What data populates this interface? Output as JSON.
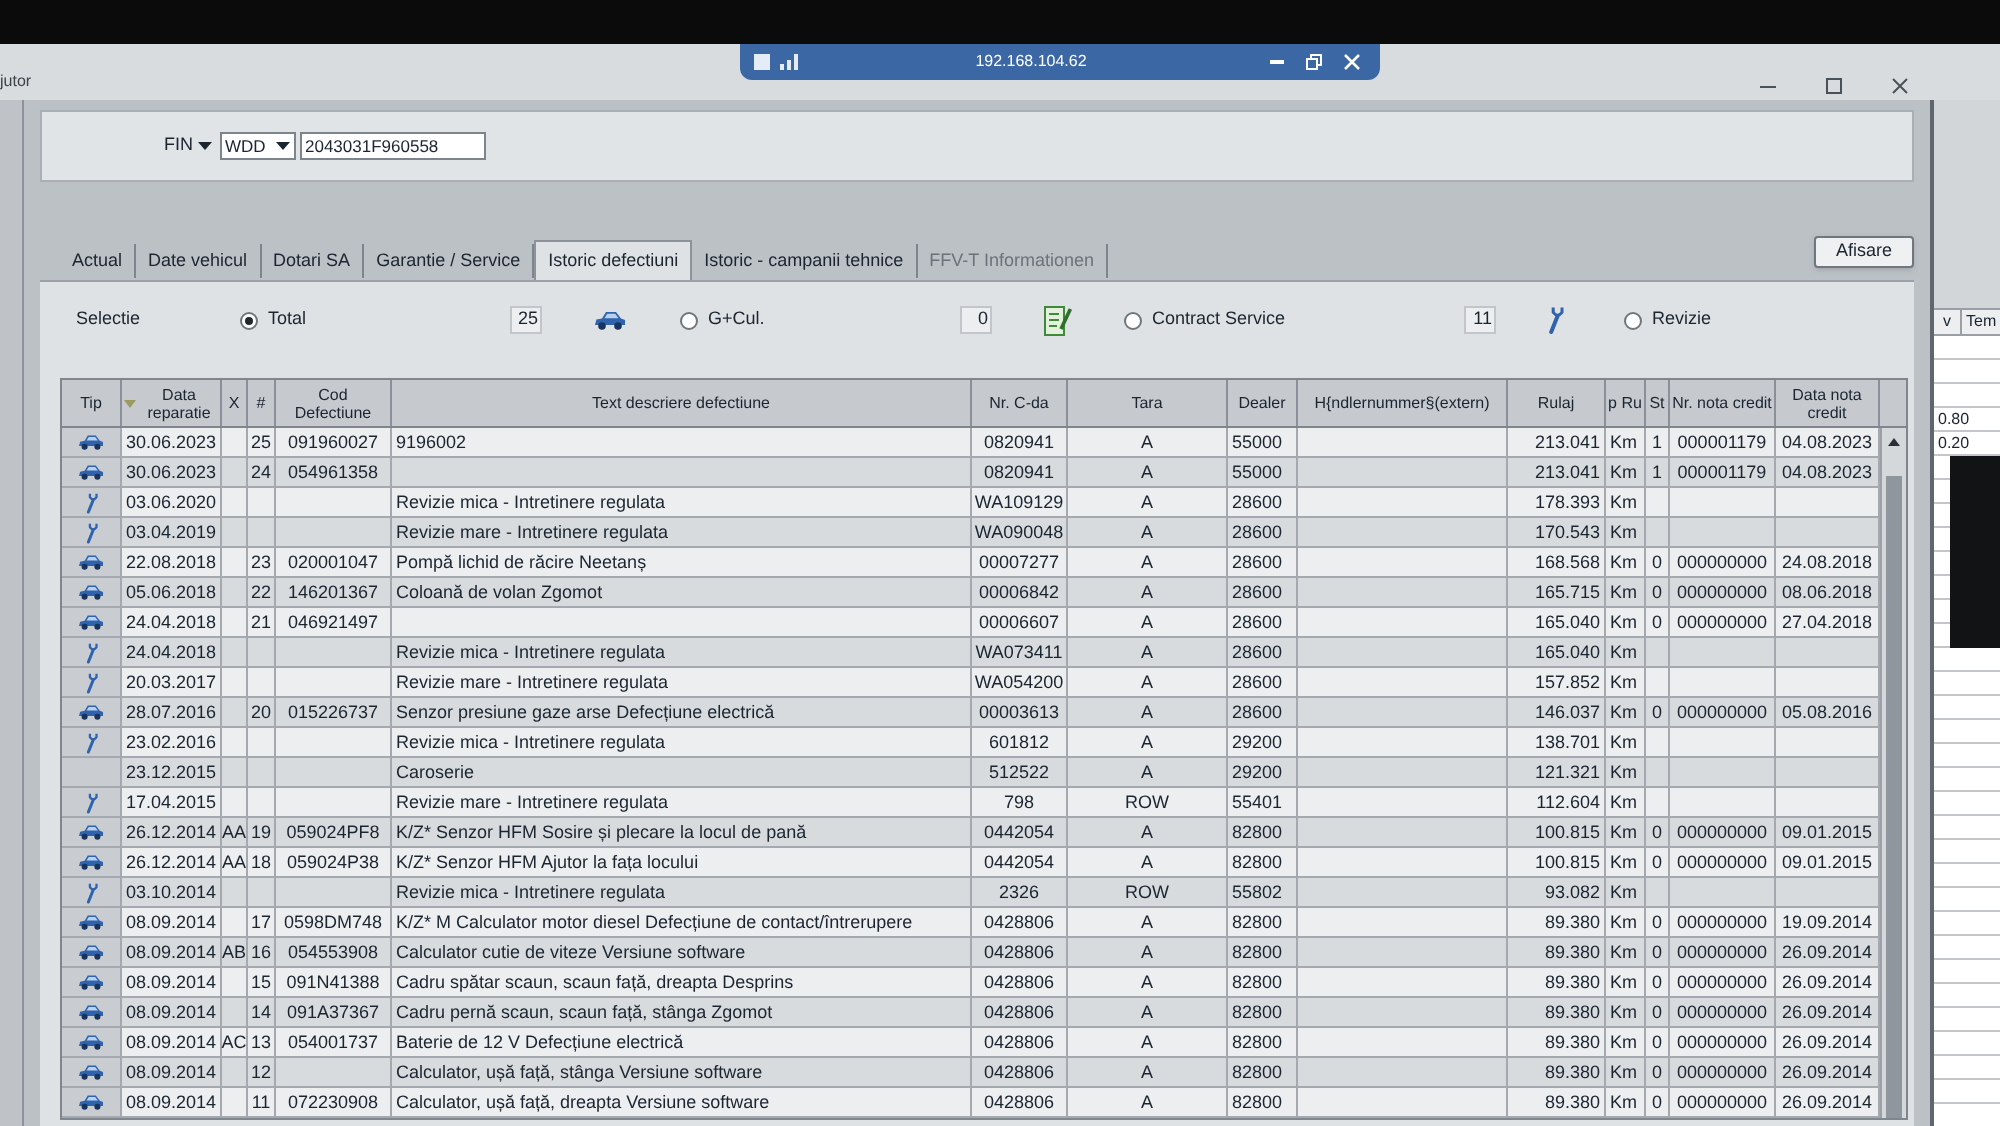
{
  "remote_bar": {
    "title": "192.168.104.62"
  },
  "menu_bar": {
    "items": [
      "jutor"
    ]
  },
  "vehicle": {
    "fin_label": "FIN",
    "prefix": "WDD",
    "vin": "2043031F960558"
  },
  "tabs": [
    {
      "label": "Actual",
      "selected": false,
      "disabled": false
    },
    {
      "label": "Date vehicul",
      "selected": false,
      "disabled": false
    },
    {
      "label": "Dotari SA",
      "selected": false,
      "disabled": false
    },
    {
      "label": "Garantie / Service",
      "selected": false,
      "disabled": false
    },
    {
      "label": "Istoric defectiuni",
      "selected": true,
      "disabled": false
    },
    {
      "label": "Istoric - campanii tehnice",
      "selected": false,
      "disabled": false
    },
    {
      "label": "FFV-T Informationen",
      "selected": false,
      "disabled": true
    }
  ],
  "display_button": {
    "label": "Afisare"
  },
  "selection": {
    "label": "Selectie",
    "items": [
      {
        "kind": "radio",
        "label": "Total",
        "selected": true
      },
      {
        "kind": "defects",
        "count": "25"
      },
      {
        "kind": "radio",
        "label": "G+Cul.",
        "selected": false
      },
      {
        "kind": "notes",
        "count": "0"
      },
      {
        "kind": "radio",
        "label": "Contract Service",
        "selected": false
      },
      {
        "kind": "services",
        "count": "11"
      },
      {
        "kind": "radio",
        "label": "Revizie",
        "selected": false
      }
    ]
  },
  "table": {
    "columns": [
      {
        "label": "Tip",
        "sorted": false
      },
      {
        "label": "Data reparatie",
        "sorted": true
      },
      {
        "label": "X",
        "sorted": false
      },
      {
        "label": "#",
        "sorted": false
      },
      {
        "label": "Cod Defectiune",
        "sorted": false
      },
      {
        "label": "Text descriere defectiune",
        "sorted": false
      },
      {
        "label": "Nr. C-da",
        "sorted": false
      },
      {
        "label": "Tara",
        "sorted": false
      },
      {
        "label": "Dealer",
        "sorted": false
      },
      {
        "label": "H{ndlernummer§(extern)",
        "sorted": false
      },
      {
        "label": "Rulaj",
        "sorted": false
      },
      {
        "label": "p Ru",
        "sorted": false
      },
      {
        "label": "St",
        "sorted": false
      },
      {
        "label": "Nr. nota credit",
        "sorted": false
      },
      {
        "label": "Data nota credit",
        "sorted": false
      }
    ],
    "rows": [
      {
        "kind": "defect",
        "date": "30.06.2023",
        "no": "25",
        "code": "091960027",
        "text": "9196002",
        "order": "0820941",
        "country": "A",
        "dealer": "55000",
        "mileage": "213.041",
        "unit": "Km",
        "st": "1",
        "credit_no": "000001179",
        "credit_date": "04.08.2023"
      },
      {
        "kind": "defect",
        "date": "30.06.2023",
        "no": "24",
        "code": "054961358",
        "order": "0820941",
        "country": "A",
        "dealer": "55000",
        "mileage": "213.041",
        "unit": "Km",
        "st": "1",
        "credit_no": "000001179",
        "credit_date": "04.08.2023"
      },
      {
        "kind": "service",
        "date": "03.06.2020",
        "text": "Revizie mica - Intretinere regulata",
        "order": "WA109129",
        "country": "A",
        "dealer": "28600",
        "mileage": "178.393",
        "unit": "Km"
      },
      {
        "kind": "service",
        "date": "03.04.2019",
        "text": "Revizie mare - Intretinere regulata",
        "order": "WA090048",
        "country": "A",
        "dealer": "28600",
        "mileage": "170.543",
        "unit": "Km"
      },
      {
        "kind": "defect",
        "date": "22.08.2018",
        "no": "23",
        "code": "020001047",
        "text": "Pompă lichid de răcire Neetanș",
        "order": "00007277",
        "country": "A",
        "dealer": "28600",
        "mileage": "168.568",
        "unit": "Km",
        "st": "0",
        "credit_no": "000000000",
        "credit_date": "24.08.2018"
      },
      {
        "kind": "defect",
        "date": "05.06.2018",
        "no": "22",
        "code": "146201367",
        "text": "Coloană de volan Zgomot",
        "order": "00006842",
        "country": "A",
        "dealer": "28600",
        "mileage": "165.715",
        "unit": "Km",
        "st": "0",
        "credit_no": "000000000",
        "credit_date": "08.06.2018"
      },
      {
        "kind": "defect",
        "date": "24.04.2018",
        "no": "21",
        "code": "046921497",
        "order": "00006607",
        "country": "A",
        "dealer": "28600",
        "mileage": "165.040",
        "unit": "Km",
        "st": "0",
        "credit_no": "000000000",
        "credit_date": "27.04.2018"
      },
      {
        "kind": "service",
        "date": "24.04.2018",
        "text": "Revizie mica - Intretinere regulata",
        "order": "WA073411",
        "country": "A",
        "dealer": "28600",
        "mileage": "165.040",
        "unit": "Km"
      },
      {
        "kind": "service",
        "date": "20.03.2017",
        "text": "Revizie mare - Intretinere regulata",
        "order": "WA054200",
        "country": "A",
        "dealer": "28600",
        "mileage": "157.852",
        "unit": "Km"
      },
      {
        "kind": "defect",
        "date": "28.07.2016",
        "no": "20",
        "code": "015226737",
        "text": "Senzor presiune gaze arse Defecțiune electrică",
        "order": "00003613",
        "country": "A",
        "dealer": "28600",
        "mileage": "146.037",
        "unit": "Km",
        "st": "0",
        "credit_no": "000000000",
        "credit_date": "05.08.2016"
      },
      {
        "kind": "service",
        "date": "23.02.2016",
        "text": "Revizie mica - Intretinere regulata",
        "order": "601812",
        "country": "A",
        "dealer": "29200",
        "mileage": "138.701",
        "unit": "Km"
      },
      {
        "kind": "other",
        "date": "23.12.2015",
        "text": "Caroserie",
        "order": "512522",
        "country": "A",
        "dealer": "29200",
        "mileage": "121.321",
        "unit": "Km"
      },
      {
        "kind": "service",
        "date": "17.04.2015",
        "text": "Revizie mare - Intretinere regulata",
        "order": "798",
        "country": "ROW",
        "dealer": "55401",
        "mileage": "112.604",
        "unit": "Km"
      },
      {
        "kind": "defect",
        "date": "26.12.2014",
        "x": "AA",
        "no": "19",
        "code": "059024PF8",
        "text": "K/Z* Senzor HFM Sosire și plecare la locul de pană",
        "order": "0442054",
        "country": "A",
        "dealer": "82800",
        "mileage": "100.815",
        "unit": "Km",
        "st": "0",
        "credit_no": "000000000",
        "credit_date": "09.01.2015"
      },
      {
        "kind": "defect",
        "date": "26.12.2014",
        "x": "AA",
        "no": "18",
        "code": "059024P38",
        "text": "K/Z* Senzor HFM Ajutor la fața locului",
        "order": "0442054",
        "country": "A",
        "dealer": "82800",
        "mileage": "100.815",
        "unit": "Km",
        "st": "0",
        "credit_no": "000000000",
        "credit_date": "09.01.2015"
      },
      {
        "kind": "service",
        "date": "03.10.2014",
        "text": "Revizie mica - Intretinere regulata",
        "order": "2326",
        "country": "ROW",
        "dealer": "55802",
        "mileage": "93.082",
        "unit": "Km"
      },
      {
        "kind": "defect",
        "date": "08.09.2014",
        "no": "17",
        "code": "0598DM748",
        "text": "K/Z* M Calculator motor diesel Defecțiune de contact/întrerupere",
        "order": "0428806",
        "country": "A",
        "dealer": "82800",
        "mileage": "89.380",
        "unit": "Km",
        "st": "0",
        "credit_no": "000000000",
        "credit_date": "19.09.2014"
      },
      {
        "kind": "defect",
        "date": "08.09.2014",
        "x": "AB",
        "no": "16",
        "code": "054553908",
        "text": "Calculator cutie de viteze Versiune software",
        "order": "0428806",
        "country": "A",
        "dealer": "82800",
        "mileage": "89.380",
        "unit": "Km",
        "st": "0",
        "credit_no": "000000000",
        "credit_date": "26.09.2014"
      },
      {
        "kind": "defect",
        "date": "08.09.2014",
        "no": "15",
        "code": "091N41388",
        "text": "Cadru spătar scaun, scaun față, dreapta Desprins",
        "order": "0428806",
        "country": "A",
        "dealer": "82800",
        "mileage": "89.380",
        "unit": "Km",
        "st": "0",
        "credit_no": "000000000",
        "credit_date": "26.09.2014"
      },
      {
        "kind": "defect",
        "date": "08.09.2014",
        "no": "14",
        "code": "091A37367",
        "text": "Cadru pernă scaun, scaun față, stânga Zgomot",
        "order": "0428806",
        "country": "A",
        "dealer": "82800",
        "mileage": "89.380",
        "unit": "Km",
        "st": "0",
        "credit_no": "000000000",
        "credit_date": "26.09.2014"
      },
      {
        "kind": "defect",
        "date": "08.09.2014",
        "x": "AC",
        "no": "13",
        "code": "054001737",
        "text": "Baterie de 12 V Defecțiune electrică",
        "order": "0428806",
        "country": "A",
        "dealer": "82800",
        "mileage": "89.380",
        "unit": "Km",
        "st": "0",
        "credit_no": "000000000",
        "credit_date": "26.09.2014"
      },
      {
        "kind": "defect",
        "date": "08.09.2014",
        "no": "12",
        "text": "Calculator, ușă față, stânga Versiune software",
        "order": "0428806",
        "country": "A",
        "dealer": "82800",
        "mileage": "89.380",
        "unit": "Km",
        "st": "0",
        "credit_no": "000000000",
        "credit_date": "26.09.2014"
      },
      {
        "kind": "defect",
        "date": "08.09.2014",
        "no": "11",
        "code": "072230908",
        "text": "Calculator, ușă față, dreapta Versiune software",
        "order": "0428806",
        "country": "A",
        "dealer": "82800",
        "mileage": "89.380",
        "unit": "Km",
        "st": "0",
        "credit_no": "000000000",
        "credit_date": "26.09.2014"
      }
    ]
  },
  "side_window": {
    "columns": [
      "v",
      "Tem"
    ],
    "values": [
      "0.80",
      "0.20"
    ]
  }
}
